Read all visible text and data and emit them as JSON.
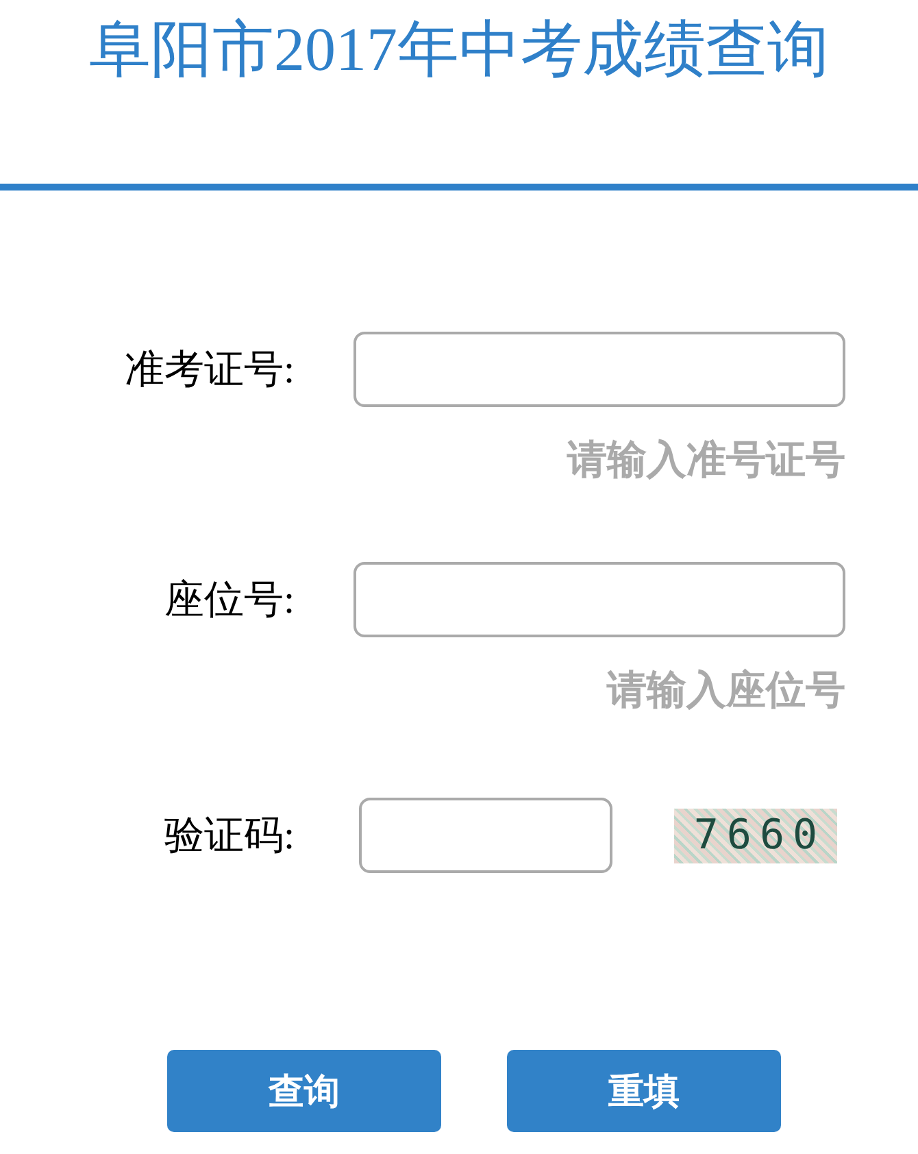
{
  "header": {
    "title": "阜阳市2017年中考成绩查询"
  },
  "form": {
    "fields": [
      {
        "kind": "text",
        "label": "准考证号:",
        "hint": "请输入准号证号"
      },
      {
        "kind": "text",
        "label": "座位号:",
        "hint": "请输入座位号"
      },
      {
        "kind": "captcha",
        "label": "验证码:",
        "captcha": "7660"
      }
    ]
  },
  "buttons": [
    {
      "label": "查询"
    },
    {
      "label": "重填"
    }
  ]
}
